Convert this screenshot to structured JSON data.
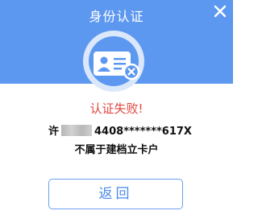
{
  "dialog": {
    "title": "身份认证",
    "close_icon": "close-icon",
    "status_icon": "id-card-error-icon",
    "message": "认证失败!",
    "id_prefix": "许",
    "id_number": "4408*******617X",
    "sub_message": "不属于建档立卡户",
    "back_label": "返回"
  },
  "colors": {
    "header": "#5d98f0",
    "error_text": "#e2463f",
    "button_text": "#4a8aee",
    "button_border": "#6aa0ef"
  }
}
